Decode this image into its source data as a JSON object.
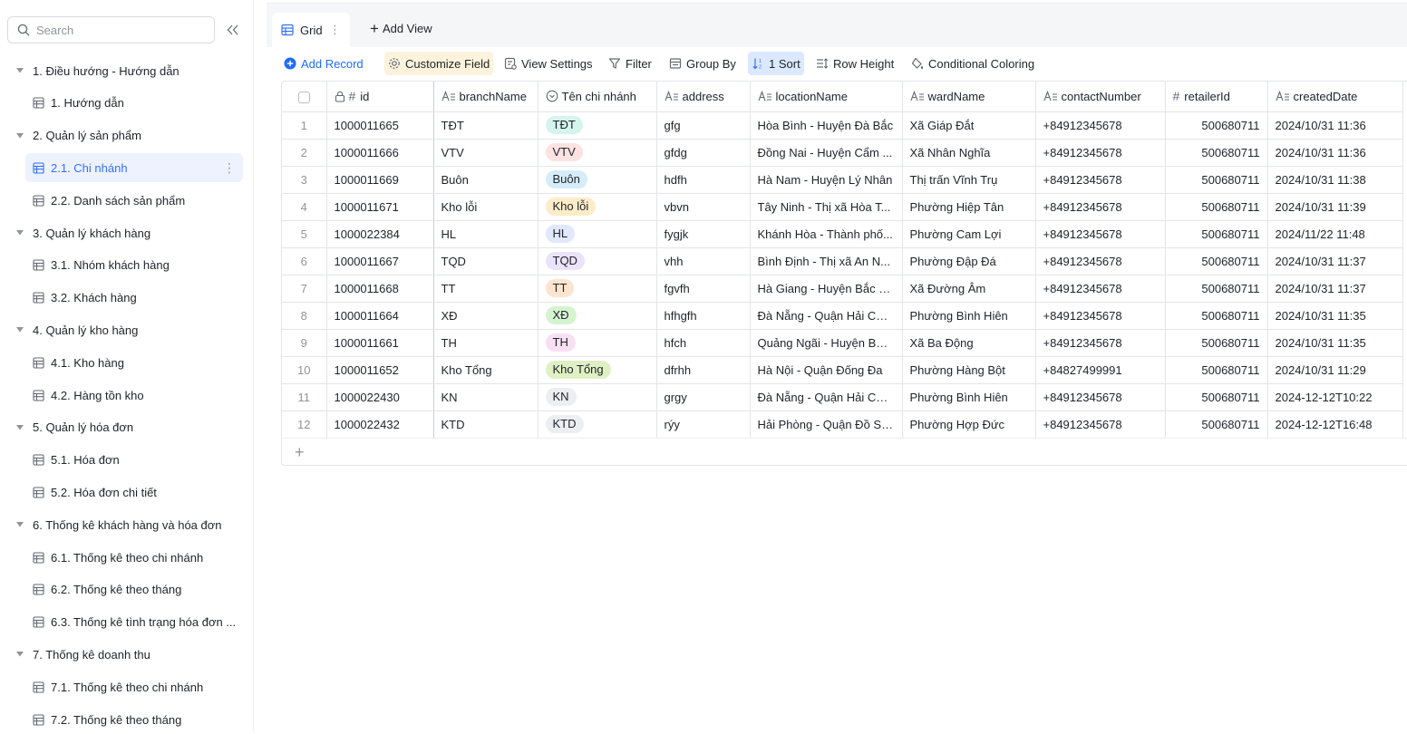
{
  "sidebar": {
    "search_placeholder": "Search",
    "groups": [
      {
        "label": "1. Điều hướng - Hướng dẫn",
        "items": [
          {
            "label": "1. Hướng dẫn"
          }
        ]
      },
      {
        "label": "2. Quản lý sản phẩm",
        "items": [
          {
            "label": "2.1. Chi nhánh",
            "active": true
          },
          {
            "label": "2.2. Danh sách sản phẩm"
          }
        ]
      },
      {
        "label": "3. Quản lý khách hàng",
        "items": [
          {
            "label": "3.1. Nhóm khách hàng"
          },
          {
            "label": "3.2. Khách hàng"
          }
        ]
      },
      {
        "label": "4. Quản lý kho hàng",
        "items": [
          {
            "label": "4.1. Kho hàng"
          },
          {
            "label": "4.2. Hàng tồn kho"
          }
        ]
      },
      {
        "label": "5. Quản lý hóa đơn",
        "items": [
          {
            "label": "5.1. Hóa đơn"
          },
          {
            "label": "5.2. Hóa đơn chi tiết"
          }
        ]
      },
      {
        "label": "6. Thống kê khách hàng và hóa đơn",
        "items": [
          {
            "label": "6.1. Thống kê theo chi nhánh"
          },
          {
            "label": "6.2. Thống kê theo tháng"
          },
          {
            "label": "6.3. Thống kê tình trạng hóa đơn ..."
          }
        ]
      },
      {
        "label": "7. Thống kê doanh thu",
        "items": [
          {
            "label": "7.1. Thống kê theo chi nhánh"
          },
          {
            "label": "7.2. Thống kê theo tháng"
          }
        ]
      }
    ]
  },
  "view_tabs": {
    "active": "Grid",
    "add_view": "Add View"
  },
  "toolbar": {
    "add_record": "Add Record",
    "customize_field": "Customize Field",
    "view_settings": "View Settings",
    "filter": "Filter",
    "group_by": "Group By",
    "sort": "1 Sort",
    "row_height": "Row Height",
    "conditional_coloring": "Conditional Coloring"
  },
  "colors": {
    "accent": "#3370ff",
    "customize_bg": "#fdf3dc",
    "sort_bg": "#dbe8fd"
  },
  "table": {
    "columns": [
      "id",
      "branchName",
      "Tên chi nhánh",
      "address",
      "locationName",
      "wardName",
      "contactNumber",
      "retailerId",
      "createdDate"
    ],
    "rows": [
      {
        "n": "1",
        "id": "1000011665",
        "branchName": "TĐT",
        "tag": "TĐT",
        "tag_color": "#d5f4ee",
        "address": "gfg",
        "locationName": "Hòa Bình - Huyện Đà Bắc",
        "wardName": "Xã Giáp Đắt",
        "contactNumber": "+84912345678",
        "retailerId": "500680711",
        "createdDate": "2024/10/31 11:36"
      },
      {
        "n": "2",
        "id": "1000011666",
        "branchName": "VTV",
        "tag": "VTV",
        "tag_color": "#fde2e2",
        "address": "gfdg",
        "locationName": "Đồng Nai - Huyện Cẩm ...",
        "wardName": "Xã Nhân Nghĩa",
        "contactNumber": "+84912345678",
        "retailerId": "500680711",
        "createdDate": "2024/10/31 11:36"
      },
      {
        "n": "3",
        "id": "1000011669",
        "branchName": "Buôn",
        "tag": "Buôn",
        "tag_color": "#d5edf8",
        "address": "hdfh",
        "locationName": "Hà Nam - Huyện Lý Nhân",
        "wardName": "Thị trấn Vĩnh Trụ",
        "contactNumber": "+84912345678",
        "retailerId": "500680711",
        "createdDate": "2024/10/31 11:38"
      },
      {
        "n": "4",
        "id": "1000011671",
        "branchName": "Kho lỗi",
        "tag": "Kho lỗi",
        "tag_color": "#fdecc8",
        "address": "vbvn",
        "locationName": "Tây Ninh - Thị xã Hòa T...",
        "wardName": "Phường Hiệp Tân",
        "contactNumber": "+84912345678",
        "retailerId": "500680711",
        "createdDate": "2024/10/31 11:39"
      },
      {
        "n": "5",
        "id": "1000022384",
        "branchName": "HL",
        "tag": "HL",
        "tag_color": "#e1e8fd",
        "address": "fygjk",
        "locationName": "Khánh Hòa - Thành phố...",
        "wardName": "Phường Cam Lợi",
        "contactNumber": "+84912345678",
        "retailerId": "500680711",
        "createdDate": "2024/11/22 11:48"
      },
      {
        "n": "6",
        "id": "1000011667",
        "branchName": "TQD",
        "tag": "TQD",
        "tag_color": "#ebe3fb",
        "address": "vhh",
        "locationName": "Bình Định - Thị xã An N...",
        "wardName": "Phường Đập Đá",
        "contactNumber": "+84912345678",
        "retailerId": "500680711",
        "createdDate": "2024/10/31 11:37"
      },
      {
        "n": "7",
        "id": "1000011668",
        "branchName": "TT",
        "tag": "TT",
        "tag_color": "#fde4cf",
        "address": "fgvfh",
        "locationName": "Hà Giang - Huyện Bắc Mê",
        "wardName": "Xã Đường Âm",
        "contactNumber": "+84912345678",
        "retailerId": "500680711",
        "createdDate": "2024/10/31 11:37"
      },
      {
        "n": "8",
        "id": "1000011664",
        "branchName": "XĐ",
        "tag": "XĐ",
        "tag_color": "#d6f3d0",
        "address": "hfhgfh",
        "locationName": "Đà Nẵng - Quận Hải Châu",
        "wardName": "Phường Bình Hiên",
        "contactNumber": "+84912345678",
        "retailerId": "500680711",
        "createdDate": "2024/10/31 11:35"
      },
      {
        "n": "9",
        "id": "1000011661",
        "branchName": "TH",
        "tag": "TH",
        "tag_color": "#f8e0f3",
        "address": "hfch",
        "locationName": "Quảng Ngãi - Huyện Ba ...",
        "wardName": "Xã Ba Động",
        "contactNumber": "+84912345678",
        "retailerId": "500680711",
        "createdDate": "2024/10/31 11:35"
      },
      {
        "n": "10",
        "id": "1000011652",
        "branchName": "Kho Tổng",
        "tag": "Kho Tổng",
        "tag_color": "#dff0c4",
        "address": "dfrhh",
        "locationName": "Hà Nội - Quận Đống Đa",
        "wardName": "Phường Hàng Bột",
        "contactNumber": "+84827499991",
        "retailerId": "500680711",
        "createdDate": "2024/10/31 11:29"
      },
      {
        "n": "11",
        "id": "1000022430",
        "branchName": "KN",
        "tag": "KN",
        "tag_color": "#eceef1",
        "address": "grgy",
        "locationName": "Đà Nẵng - Quận Hải Châu",
        "wardName": "Phường Bình Hiên",
        "contactNumber": "+84912345678",
        "retailerId": "500680711",
        "createdDate": "2024-12-12T10:22"
      },
      {
        "n": "12",
        "id": "1000022432",
        "branchName": "KTD",
        "tag": "KTD",
        "tag_color": "#eceef1",
        "address": "rýy",
        "locationName": "Hải Phòng - Quận Đồ Sơn",
        "wardName": "Phường Hợp Đức",
        "contactNumber": "+84912345678",
        "retailerId": "500680711",
        "createdDate": "2024-12-12T16:48"
      }
    ]
  }
}
